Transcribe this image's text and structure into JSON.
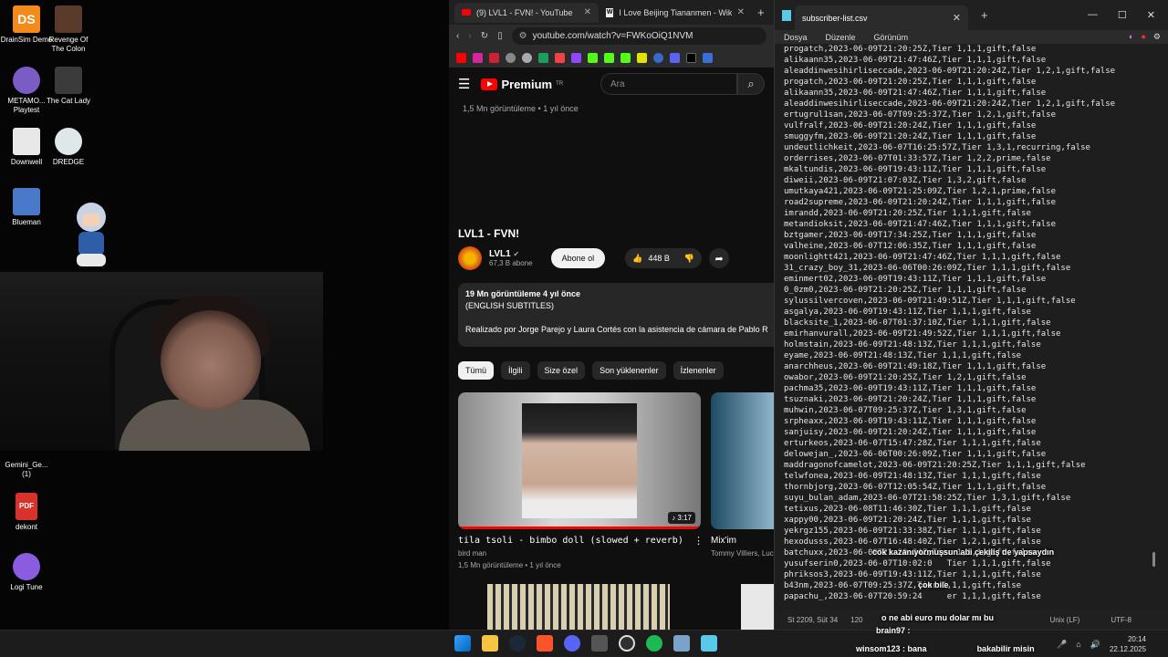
{
  "desktop": {
    "icons": [
      {
        "label": "DrainSim Demo",
        "color": "#f28a1c"
      },
      {
        "label": "Revenge Of The Colon",
        "color": "#5a3a2a"
      },
      {
        "label": "METAMO... Playtest",
        "color": "#7b5cc4"
      },
      {
        "label": "The Cat Lady",
        "color": "#3b3b3b"
      },
      {
        "label": "Downwell",
        "color": "#e8e8e8"
      },
      {
        "label": "DREDGE",
        "color": "#dfe7ea"
      },
      {
        "label": "Blueman",
        "color": "#4a79c9"
      },
      {
        "label": "Gemini_Ge... (1)",
        "color": "#2b2b2b"
      },
      {
        "label": "dekont",
        "color": "#d9322b"
      },
      {
        "label": "Logi Tune",
        "color": "#8c5ce0"
      }
    ]
  },
  "browser": {
    "tabs": [
      {
        "label": "(9) LVL1 - FVN! - YouTube",
        "icon": "youtube-icon"
      },
      {
        "label": "I Love Beijing Tiananmen - Wikipedia",
        "icon": "wikipedia-icon"
      }
    ],
    "new_tab": "+",
    "url": "youtube.com/watch?v=FWKoOiQ1NVM",
    "youtube": {
      "logo": "Premium",
      "logo_region": "TR",
      "search_placeholder": "Ara",
      "above_meta": "1,5 Mn görüntüleme • 1 yıl önce",
      "video_title": "LVL1 - FVN!",
      "channel_name": "LVL1",
      "channel_subs": "67,3 B abone",
      "subscribe": "Abone ol",
      "likes": "448 B",
      "description": {
        "views_line": "19 Mn görüntüleme  4 yıl önce",
        "line2": "(ENGLISH SUBTITLES)",
        "line3": "Realizado por Jorge Parejo y Laura Cortés con la asistencia de cámara de Pablo R"
      },
      "chips": [
        "Tümü",
        "İlgili",
        "Size özel",
        "Son yüklenenler",
        "İzlenenler"
      ],
      "recommendations": [
        {
          "title": "tila tsoli - bimbo doll (slowed + reverb)",
          "channel": "bird man",
          "meta": "1,5 Mn görüntüleme • 1 yıl önce",
          "duration": "♪ 3:17"
        },
        {
          "title": "Mix'im",
          "channel": "Tommy Villiers, Luc"
        }
      ]
    }
  },
  "notepad": {
    "tab_title": "subscriber-list.csv",
    "menu": [
      "Dosya",
      "Düzenle",
      "Görünüm"
    ],
    "lines": [
      "progatch,2023-06-09T21:20:25Z,Tier 1,1,1,gift,false",
      "alikaann35,2023-06-09T21:47:46Z,Tier 1,1,1,gift,false",
      "aleaddinwesihirliseccade,2023-06-09T21:20:24Z,Tier 1,2,1,gift,false",
      "progatch,2023-06-09T21:20:25Z,Tier 1,1,1,gift,false",
      "alikaann35,2023-06-09T21:47:46Z,Tier 1,1,1,gift,false",
      "aleaddinwesihirliseccade,2023-06-09T21:20:24Z,Tier 1,2,1,gift,false",
      "ertugrul1san,2023-06-07T09:25:37Z,Tier 1,2,1,gift,false",
      "vulfralf,2023-06-09T21:20:24Z,Tier 1,1,1,gift,false",
      "smuggyfm,2023-06-09T21:20:24Z,Tier 1,1,1,gift,false",
      "undeutlichkeit,2023-06-07T16:25:57Z,Tier 1,3,1,recurring,false",
      "orderrises,2023-06-07T01:33:57Z,Tier 1,2,2,prime,false",
      "mkaltundis,2023-06-09T19:43:11Z,Tier 1,1,1,gift,false",
      "diweii,2023-06-09T21:07:03Z,Tier 1,3,2,gift,false",
      "umutkaya421,2023-06-09T21:25:09Z,Tier 1,2,1,prime,false",
      "road2supreme,2023-06-09T21:20:24Z,Tier 1,1,1,gift,false",
      "imrandd,2023-06-09T21:20:25Z,Tier 1,1,1,gift,false",
      "metandioksit,2023-06-09T21:47:46Z,Tier 1,1,1,gift,false",
      "bztgamer,2023-06-09T17:34:25Z,Tier 1,1,1,gift,false",
      "valheine,2023-06-07T12:06:35Z,Tier 1,1,1,gift,false",
      "moonlightt421,2023-06-09T21:47:46Z,Tier 1,1,1,gift,false",
      "31_crazy_boy_31,2023-06-06T00:26:09Z,Tier 1,1,1,gift,false",
      "eminmert02,2023-06-09T19:43:11Z,Tier 1,1,1,gift,false",
      "0_0zm0,2023-06-09T21:20:25Z,Tier 1,1,1,gift,false",
      "sylussilvercoven,2023-06-09T21:49:51Z,Tier 1,1,1,gift,false",
      "asgalya,2023-06-09T19:43:11Z,Tier 1,1,1,gift,false",
      "blacksite_1,2023-06-07T01:37:10Z,Tier 1,1,1,gift,false",
      "emirhanvurall,2023-06-09T21:49:52Z,Tier 1,1,1,gift,false",
      "holmstain,2023-06-09T21:48:13Z,Tier 1,1,1,gift,false",
      "eyame,2023-06-09T21:48:13Z,Tier 1,1,1,gift,false",
      "anarchheus,2023-06-09T21:49:18Z,Tier 1,1,1,gift,false",
      "owabor,2023-06-09T21:20:25Z,Tier 1,2,1,gift,false",
      "pachma35,2023-06-09T19:43:11Z,Tier 1,1,1,gift,false",
      "tsuznaki,2023-06-09T21:20:24Z,Tier 1,1,1,gift,false",
      "muhwin,2023-06-07T09:25:37Z,Tier 1,3,1,gift,false",
      "srpheaxx,2023-06-09T19:43:11Z,Tier 1,1,1,gift,false",
      "sanjuisy,2023-06-09T21:20:24Z,Tier 1,1,1,gift,false",
      "erturkeos,2023-06-07T15:47:28Z,Tier 1,1,1,gift,false",
      "delowejan_,2023-06-06T00:26:09Z,Tier 1,1,1,gift,false",
      "maddragonofcamelot,2023-06-09T21:20:25Z,Tier 1,1,1,gift,false",
      "telwfonea,2023-06-09T21:48:13Z,Tier 1,1,1,gift,false",
      "thornbjorg,2023-06-07T12:05:54Z,Tier 1,1,1,gift,false",
      "suyu_bulan_adam,2023-06-07T21:58:25Z,Tier 1,3,1,gift,false",
      "tetixus,2023-06-08T11:46:30Z,Tier 1,1,1,gift,false",
      "xappy00,2023-06-09T21:20:24Z,Tier 1,1,1,gift,false",
      "yekrgz155,2023-06-09T21:33:38Z,Tier 1,1,1,gift,false",
      "hexodusss,2023-06-07T16:48:40Z,Tier 1,2,1,gift,false",
      "batchuxx,2023-06-09T21:20:24Z,Tier 1,1,1,gift,false",
      "yusufserin0,2023-06-07T10:02:0   Tier 1,1,1,gift,false",
      "phriksos3,2023-06-09T19:43:11Z,Tier 1,1,1,gift,false",
      "b43nm,2023-06-07T09:25:37Z,Tier 1,1,1,gift,false",
      "papachu_,2023-06-07T20:59:24     er 1,1,1,gift,false"
    ],
    "status": {
      "position": "St 2209, Süt 34",
      "chars": "120",
      "line_ending": "Unix (LF)",
      "encoding": "UTF-8"
    }
  },
  "chat": [
    {
      "user": "",
      "text": "cok kazanıyormuşsun abi çekiliş de yapsaydın"
    },
    {
      "user": "",
      "text": "çok bile"
    },
    {
      "user": "",
      "text": "o ne abi euro mu dolar mı bu"
    },
    {
      "user": "brain97 :",
      "text": ""
    },
    {
      "user": "winsom123 : bana",
      "text": "bakabilir misin"
    }
  ],
  "taskbar": {
    "time": "20:14",
    "date": "22.12.2025"
  }
}
